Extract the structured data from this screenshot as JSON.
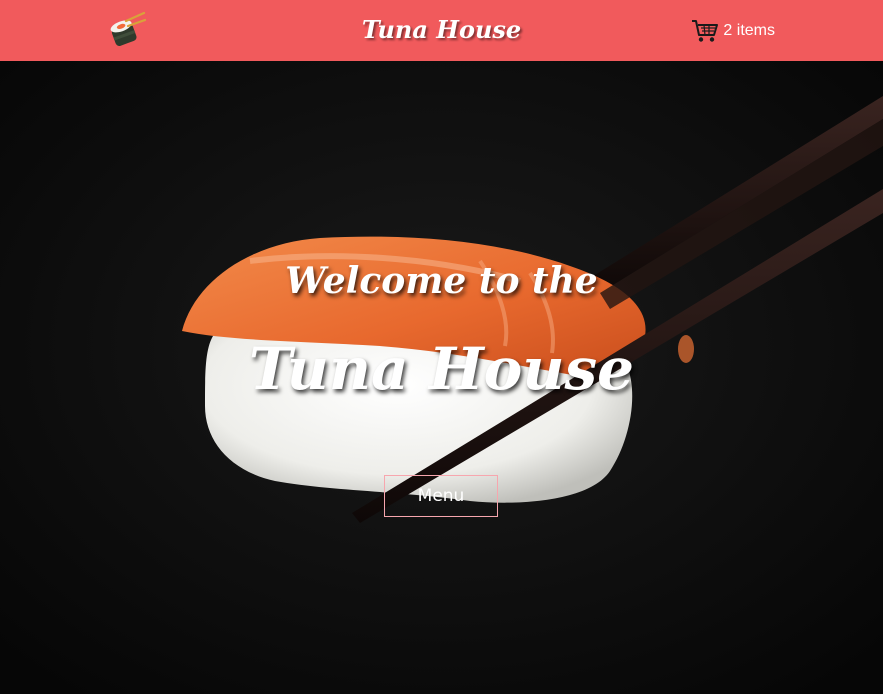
{
  "colors": {
    "header_bg": "#f15a5c",
    "hero_bg": "#0c0c0c",
    "salmon": "#f07a3a",
    "rice": "#f5f5f2",
    "chopsticks": "#1e1210",
    "menu_border": "#f7a6ae",
    "text": "#ffffff"
  },
  "header": {
    "logo_icon": "sushi-icon",
    "brand": "Tuna House",
    "cart_icon": "shopping-cart-icon",
    "cart_label": "2 items"
  },
  "hero": {
    "background_image": "salmon nigiri held by chopsticks",
    "subtitle": "Welcome to the",
    "title": "Tuna House",
    "menu_button_label": "Menu"
  }
}
